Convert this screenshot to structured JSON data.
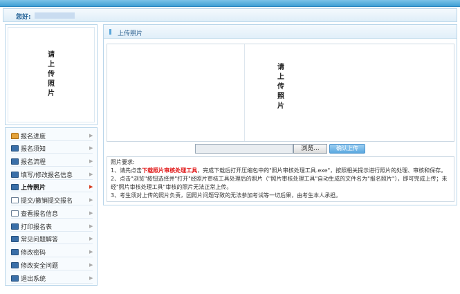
{
  "header": {
    "greeting": "您好:"
  },
  "left_photo": {
    "chars": [
      "请",
      "上",
      "传",
      "照",
      "片"
    ]
  },
  "menu": {
    "items": [
      {
        "label": "报名进度",
        "icon": "home-icon",
        "active": false
      },
      {
        "label": "报名须知",
        "icon": "notice-icon",
        "active": false
      },
      {
        "label": "报名流程",
        "icon": "flow-icon",
        "active": false
      },
      {
        "label": "填写/修改报名信息",
        "icon": "edit-icon",
        "active": false
      },
      {
        "label": "上传照片",
        "icon": "photo-icon",
        "active": true
      },
      {
        "label": "提交/撤销提交报名",
        "icon": "submit-doc-icon",
        "active": false
      },
      {
        "label": "查看报名信息",
        "icon": "view-doc-icon",
        "active": false
      },
      {
        "label": "打印报名表",
        "icon": "print-icon",
        "active": false
      },
      {
        "label": "常见问题解答",
        "icon": "faq-icon",
        "active": false
      },
      {
        "label": "修改密码",
        "icon": "password-icon",
        "active": false
      },
      {
        "label": "修改安全问题",
        "icon": "security-icon",
        "active": false
      },
      {
        "label": "退出系统",
        "icon": "exit-icon",
        "active": false
      }
    ],
    "arrow": "▶"
  },
  "panel": {
    "title": "上传照片",
    "photo_chars": [
      "请",
      "上",
      "传",
      "照",
      "片"
    ],
    "browse_label": "浏览...",
    "confirm_label": "确认上传",
    "requirements": {
      "heading": "照片要求:",
      "line1_prefix": "1、请先点击",
      "line1_link": "下载照片审核处理工具",
      "line1_suffix": "，完成下载后打开压缩包中的\"照片审核处理工具.exe\"，按照相关提示进行照片的处理、审核和保存。",
      "line2a": "2、点击\"浏览\"按钮选择并\"打开\"经照片审核工具处理后的照片（\"照片审核处理工具\"自动生成的文件名为\"报名照片\"），即可完成上传；未",
      "line2b": "经\"照片审核处理工具\"审核的照片无法正常上传。",
      "line3": "3、考生须对上传的照片负责，因照片问题导致的无法参加考试等一切后果，由考生本人承担。"
    }
  },
  "colors": {
    "accent": "#3f9fd4",
    "link_red": "#e01212",
    "border": "#b9d6ea"
  }
}
